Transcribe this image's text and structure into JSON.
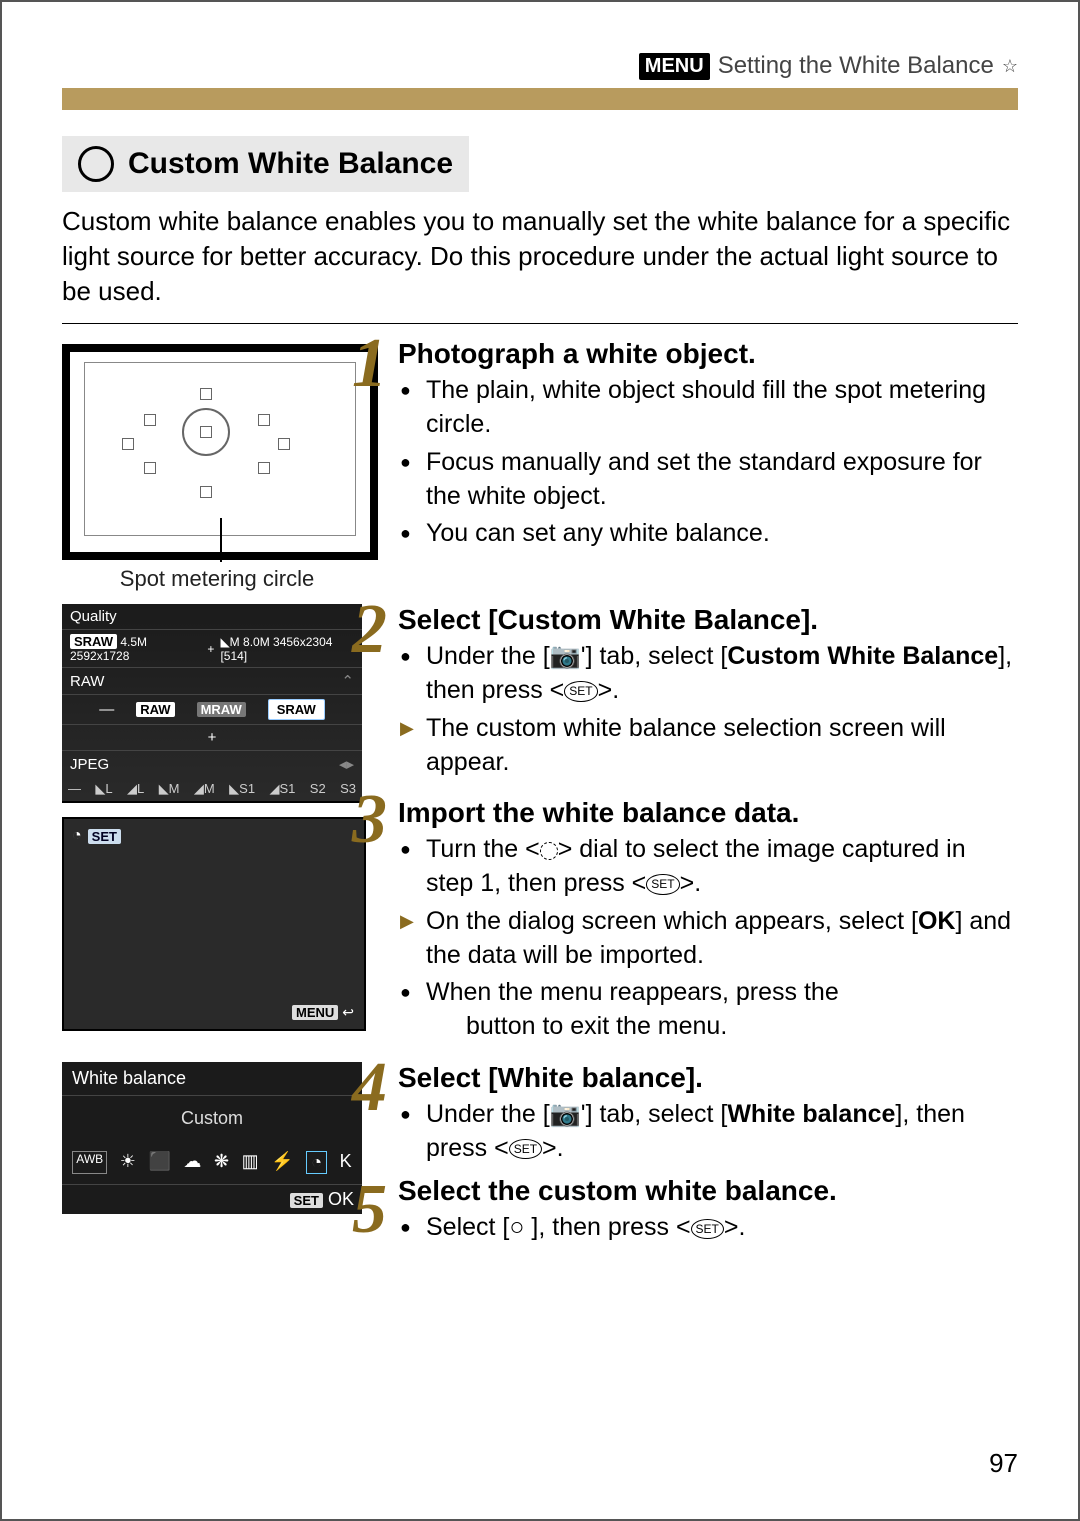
{
  "header": {
    "menu_label": "MENU",
    "title_suffix": "Setting the White Balance",
    "star": "☆"
  },
  "section_heading": "Custom White Balance",
  "intro": "Custom white balance enables you to manually set the white balance for a specific light source for better accuracy. Do this procedure under the actual light source to be used.",
  "viewfinder_caption": "Spot metering circle",
  "quality_screen": {
    "title": "Quality",
    "line2_a": "SRAW",
    "line2_b": "4.5M 2592x1728",
    "line2_c": "+",
    "line2_d": "◣M",
    "line2_e": "8.0M 3456x2304",
    "line2_f": "[514]",
    "raw_label": "RAW",
    "raw_opts": [
      "—",
      "RAW",
      "MRAW",
      "SRAW"
    ],
    "plus": "+",
    "jpeg_label": "JPEG",
    "jpeg_opts": [
      "—",
      "◣L",
      "◢L",
      "◣M",
      "◢M",
      "◣S1",
      "◢S1",
      "S2",
      "S3"
    ]
  },
  "blank_screen": {
    "icon": "◔",
    "set": "SET",
    "menu": "MENU",
    "back": "↩"
  },
  "wb_screen": {
    "title": "White balance",
    "value": "Custom",
    "icons": [
      "AWB",
      "☀",
      "⬛",
      "☁",
      "❋",
      "▥",
      "⚡",
      "◔",
      "K"
    ],
    "set": "SET",
    "ok": "OK"
  },
  "steps": [
    {
      "num": "1",
      "title": "Photograph a white object.",
      "items": [
        {
          "text": "The plain, white object should fill the spot metering circle."
        },
        {
          "text": "Focus manually and set the standard exposure for the white object."
        },
        {
          "text": "You can set any white balance."
        }
      ]
    },
    {
      "num": "2",
      "title": "Select [Custom White Balance].",
      "html": [
        {
          "kind": "dot",
          "text": "Under the [📷ʹ] tab, select [<b>Custom White Balance</b>], then press <<span class='set-glyph'>SET</span>>."
        },
        {
          "kind": "arrow",
          "text": "The custom white balance selection screen will appear."
        }
      ]
    },
    {
      "num": "3",
      "title": "Import the white balance data.",
      "html": [
        {
          "kind": "dot",
          "text": "Turn the <<span class='dial-glyph'></span>> dial to select the image captured in step 1, then press <<span class='set-glyph'>SET</span>>."
        },
        {
          "kind": "arrow",
          "text": "On the dialog screen which appears, select [<b>OK</b>] and the data will be imported."
        },
        {
          "kind": "dot",
          "text": "When the menu reappears, press the <MENU> button to exit the menu."
        }
      ]
    },
    {
      "num": "4",
      "title": "Select [White balance].",
      "html": [
        {
          "kind": "dot",
          "text": "Under the [📷ʹ] tab, select [<b>White balance</b>], then press <<span class='set-glyph'>SET</span>>."
        }
      ]
    },
    {
      "num": "5",
      "title": "Select the custom white balance.",
      "html": [
        {
          "kind": "dot",
          "text": "Select [○ ], then press <<span class='set-glyph'>SET</span>>."
        }
      ]
    }
  ],
  "page_number": "97"
}
